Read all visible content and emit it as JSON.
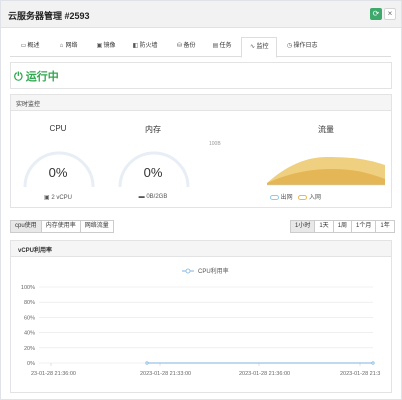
{
  "window": {
    "title": "云服务器管理 #2593"
  },
  "tabs": [
    {
      "label": "概述",
      "icon": "monitor-icon"
    },
    {
      "label": "网络",
      "icon": "network-icon"
    },
    {
      "label": "镜像",
      "icon": "image-icon"
    },
    {
      "label": "防火墙",
      "icon": "firewall-icon"
    },
    {
      "label": "备份",
      "icon": "backup-icon"
    },
    {
      "label": "任务",
      "icon": "tasks-icon"
    },
    {
      "label": "监控",
      "icon": "monitor-chart-icon"
    },
    {
      "label": "操作日志",
      "icon": "log-icon"
    }
  ],
  "active_tab": "监控",
  "status": {
    "text": "运行中",
    "color": "#2fa84f"
  },
  "realtime": {
    "header": "实时监控",
    "cpu": {
      "title": "CPU",
      "value": "0%",
      "sub": "2 vCPU",
      "usage": 0
    },
    "memory": {
      "title": "内存",
      "value": "0%",
      "sub": "0B/2GB",
      "usage": 0
    },
    "traffic": {
      "title": "流量",
      "scale_label": "100B",
      "legend_out": "出网",
      "legend_in": "入网",
      "out_color": "#8fc9e8",
      "in_color": "#e8b94b"
    }
  },
  "metric_buttons": [
    "cpu使用",
    "内存使用率",
    "网络流量"
  ],
  "active_metric": "cpu使用",
  "range_buttons": [
    "1小时",
    "1天",
    "1周",
    "1个月",
    "1年"
  ],
  "active_range": "1小时",
  "chart_panel": {
    "title": "vCPU利用率"
  },
  "chart_data": {
    "type": "line",
    "title": "",
    "series": [
      {
        "name": "CPU利用率",
        "color": "#7fb6e0",
        "values": [
          0,
          0,
          0,
          0,
          0,
          0,
          0,
          0
        ]
      }
    ],
    "ylim": [
      0,
      100
    ],
    "y_ticks": [
      "0%",
      "20%",
      "40%",
      "60%",
      "80%",
      "100%"
    ],
    "x_ticks": [
      "23-01-28 21:36:00",
      "2023-01-28 21:33:00",
      "2023-01-28 21:36:00",
      "2023-01-28 21:3"
    ],
    "grid": true,
    "legend_position": "top-center"
  }
}
